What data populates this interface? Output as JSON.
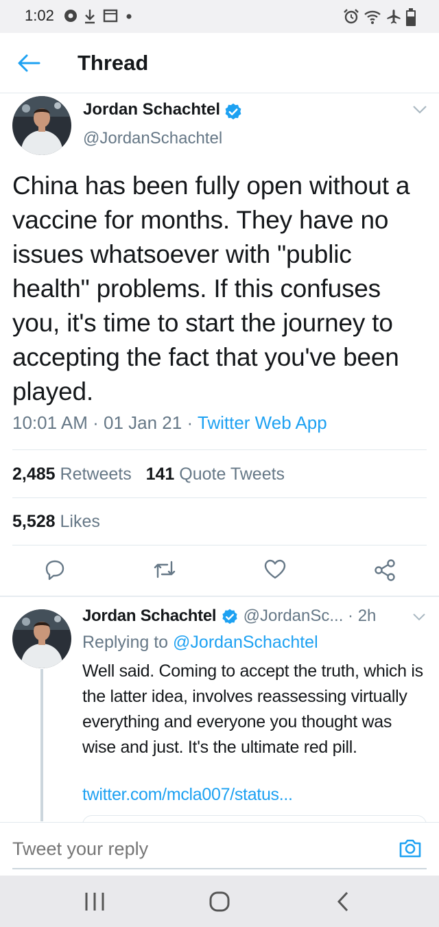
{
  "status_bar": {
    "time": "1:02",
    "icons": [
      "settings-gear-icon",
      "download-icon",
      "calendar-icon",
      "dot-icon",
      "alarm-icon",
      "wifi-icon",
      "airplane-icon",
      "battery-icon"
    ]
  },
  "header": {
    "back_icon": "arrow-left-icon",
    "title": "Thread"
  },
  "main_tweet": {
    "author_name": "Jordan Schachtel",
    "handle": "@JordanSchachtel",
    "verified": true,
    "text": "China has been fully open without a vaccine for months. They have no issues whatsoever with \"public health\" problems. If this confuses you, it's time to start the journey to accepting the fact that you've been played.",
    "time": "10:01 AM",
    "date": "01 Jan 21",
    "separator": "·",
    "source": "Twitter Web App",
    "retweets_count": "2,485",
    "retweets_label": "Retweets",
    "quotes_count": "141",
    "quotes_label": "Quote Tweets",
    "likes_count": "5,528",
    "likes_label": "Likes"
  },
  "actions": [
    "reply-icon",
    "retweet-icon",
    "like-icon",
    "share-icon"
  ],
  "reply": {
    "author_name": "Jordan Schachtel",
    "handle": "@JordanSc...",
    "time": "· 2h",
    "replying_prefix": "Replying to",
    "replying_to": "@JordanSchachtel",
    "text": "Well said. Coming to accept the truth, which is the latter idea, involves reassessing virtually everything and everyone you thought was wise and just. It's the ultimate red pill.",
    "link": "twitter.com/mcla007/status..."
  },
  "compose": {
    "placeholder": "Tweet your reply",
    "camera_icon": "camera-icon"
  },
  "nav_bar": {
    "buttons": [
      "recent-apps-icon",
      "home-icon",
      "back-icon"
    ]
  },
  "colors": {
    "accent": "#1da1f2",
    "text_primary": "#14171a",
    "text_secondary": "#657786",
    "border": "#e1e8ed"
  }
}
